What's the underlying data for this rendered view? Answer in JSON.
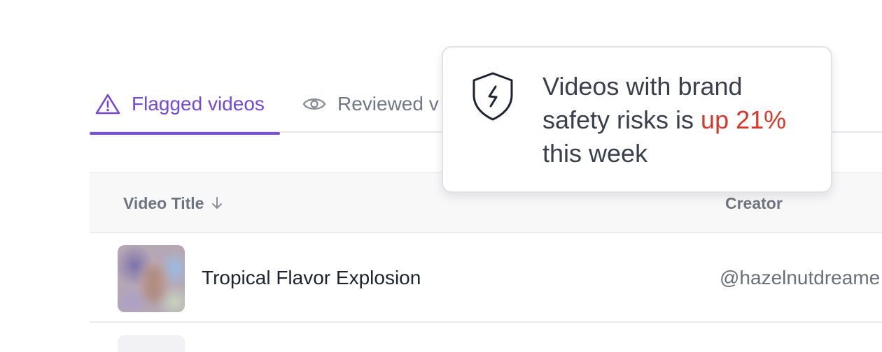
{
  "tabs": [
    {
      "label": "Flagged videos",
      "icon": "warning-triangle-icon",
      "active": true,
      "color": "#7448d8"
    },
    {
      "label": "Reviewed v",
      "icon": "eye-icon",
      "active": false
    }
  ],
  "table": {
    "columns": {
      "title": "Video Title",
      "title_sort_icon": "arrow-down-icon",
      "creator": "Creator"
    },
    "rows": [
      {
        "title": "Tropical Flavor Explosion",
        "creator": "@hazelnutdreame"
      }
    ]
  },
  "callout": {
    "icon": "shield-lightning-icon",
    "text_before": "Videos with brand safety risks is ",
    "text_highlight": "up 21%",
    "text_after": " this week",
    "highlight_color": "#d6382a"
  }
}
